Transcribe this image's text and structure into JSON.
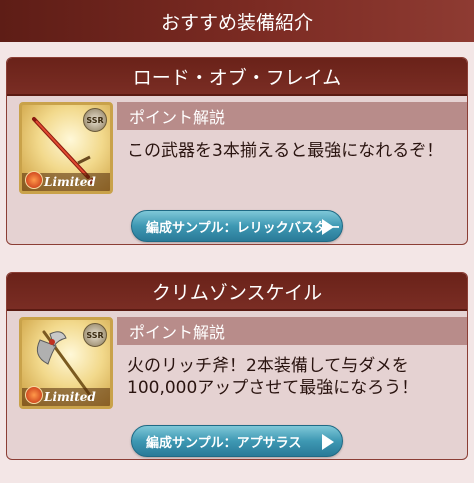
{
  "header": {
    "title": "おすすめ装備紹介"
  },
  "cards": [
    {
      "title": "ロード・オブ・フレイム",
      "rarity_badge": "SSR",
      "limited_label": "Limited",
      "point_label": "ポイント解説",
      "description": "この武器を3本揃えると最強になれるぞ！",
      "button_label": "編成サンプル：レリックバスター"
    },
    {
      "title": "クリムゾンスケイル",
      "rarity_badge": "SSR",
      "limited_label": "Limited",
      "point_label": "ポイント解説",
      "description": "火のリッチ斧！2本装備して与ダメを100,000アップさせて最強になろう！",
      "button_label": "編成サンプル：アプサラス"
    }
  ],
  "icons": {
    "button_arrow": "play-arrow-icon",
    "element": "fire-element-icon"
  }
}
